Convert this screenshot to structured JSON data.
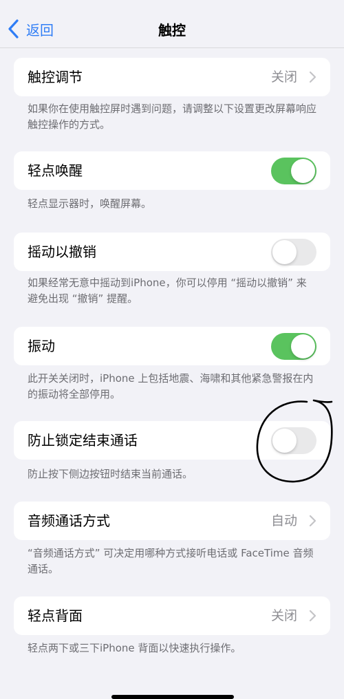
{
  "nav": {
    "back_label": "返回",
    "title": "触控"
  },
  "rows": [
    {
      "label": "触控调节",
      "value": "关闭",
      "footer": "如果你在使用触控屏时遇到问题，请调整以下设置更改屏幕响应触控操作的方式。"
    },
    {
      "label": "轻点唤醒",
      "toggle": true,
      "footer": "轻点显示器时，唤醒屏幕。"
    },
    {
      "label": "摇动以撤销",
      "toggle": false,
      "footer": "如果经常无意中摇动到iPhone，你可以停用 “摇动以撤销” 来避免出现 “撤销” 提醒。"
    },
    {
      "label": "振动",
      "toggle": true,
      "footer": "此开关关闭时，iPhone 上包括地震、海啸和其他紧急警报在内的振动将全部停用。"
    },
    {
      "label": "防止锁定结束通话",
      "toggle": false,
      "footer": "防止按下侧边按钮时结束当前通话。"
    },
    {
      "label": "音频通话方式",
      "value": "自动",
      "footer": "“音频通话方式” 可决定用哪种方式接听电话或 FaceTime 音频通话。"
    },
    {
      "label": "轻点背面",
      "value": "关闭",
      "footer": "轻点两下或三下iPhone 背面以快速执行操作。"
    }
  ],
  "colors": {
    "accent": "#2f7df6",
    "toggle_on": "#5ac35e",
    "toggle_off": "#e9e9ea"
  },
  "icons": {
    "back": "chevron-left-icon",
    "disclosure": "chevron-right-icon"
  }
}
